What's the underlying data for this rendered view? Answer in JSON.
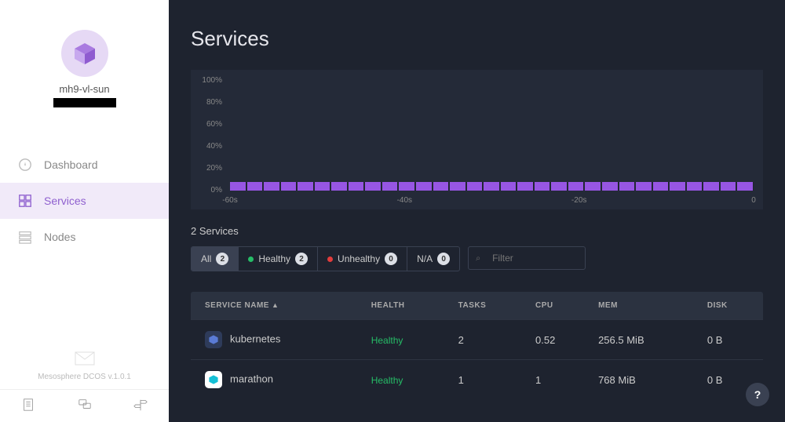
{
  "brand": {
    "cluster_name": "mh9-vl-sun",
    "footer_text": "Mesosphere DCOS v.1.0.1"
  },
  "sidebar": {
    "items": [
      {
        "label": "Dashboard",
        "icon": "gauge"
      },
      {
        "label": "Services",
        "icon": "grid"
      },
      {
        "label": "Nodes",
        "icon": "servers"
      }
    ]
  },
  "page": {
    "title": "Services",
    "summary": "2 Services"
  },
  "filters": {
    "tabs": [
      {
        "label": "All",
        "count": 2
      },
      {
        "label": "Healthy",
        "count": 2,
        "dot": "green"
      },
      {
        "label": "Unhealthy",
        "count": 0,
        "dot": "red"
      },
      {
        "label": "N/A",
        "count": 0
      }
    ],
    "placeholder": "Filter"
  },
  "table": {
    "headers": {
      "name": "SERVICE NAME",
      "health": "HEALTH",
      "tasks": "TASKS",
      "cpu": "CPU",
      "mem": "MEM",
      "disk": "DISK"
    },
    "rows": [
      {
        "name": "kubernetes",
        "health": "Healthy",
        "tasks": "2",
        "cpu": "0.52",
        "mem": "256.5 MiB",
        "disk": "0 B",
        "icon_bg": "#2e3b5a",
        "icon_fg": "#5a7bd6"
      },
      {
        "name": "marathon",
        "health": "Healthy",
        "tasks": "1",
        "cpu": "1",
        "mem": "768 MiB",
        "disk": "0 B",
        "icon_bg": "#fff",
        "icon_fg": "#15c0d6"
      }
    ]
  },
  "chart_data": {
    "type": "bar",
    "title": "",
    "ylabel": "",
    "xlabel": "",
    "ylim": [
      0,
      100
    ],
    "y_ticks": [
      "100%",
      "80%",
      "60%",
      "40%",
      "20%",
      "0%"
    ],
    "x_ticks": [
      "-60s",
      "-40s",
      "-20s",
      "0"
    ],
    "categories": [
      -60,
      -58,
      -56,
      -54,
      -52,
      -50,
      -48,
      -46,
      -44,
      -42,
      -40,
      -38,
      -36,
      -34,
      -32,
      -30,
      -28,
      -26,
      -24,
      -22,
      -20,
      -18,
      -16,
      -14,
      -12,
      -10,
      -8,
      -6,
      -4,
      -2,
      0
    ],
    "values": [
      8,
      8,
      8,
      8,
      8,
      8,
      8,
      8,
      8,
      8,
      8,
      8,
      8,
      8,
      8,
      8,
      8,
      8,
      8,
      8,
      8,
      8,
      8,
      8,
      8,
      8,
      8,
      8,
      8,
      8,
      8
    ]
  },
  "help": {
    "glyph": "?"
  }
}
